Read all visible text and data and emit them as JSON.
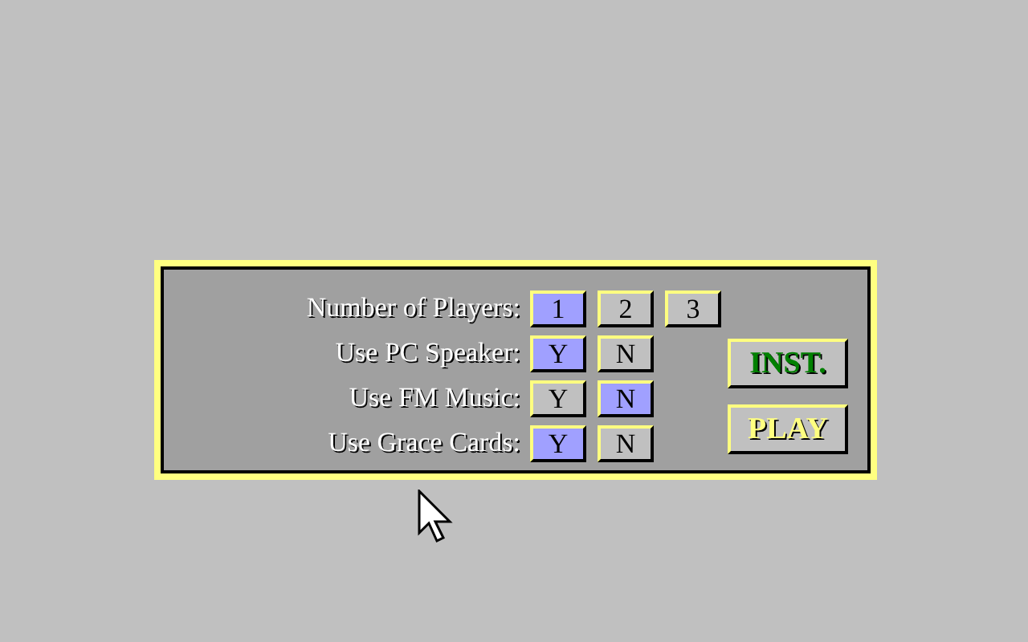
{
  "settings": [
    {
      "label": "Number of Players:",
      "options": [
        {
          "label": "1",
          "selected": true
        },
        {
          "label": "2",
          "selected": false
        },
        {
          "label": "3",
          "selected": false
        }
      ]
    },
    {
      "label": "Use PC Speaker:",
      "options": [
        {
          "label": "Y",
          "selected": true
        },
        {
          "label": "N",
          "selected": false
        }
      ]
    },
    {
      "label": "Use FM Music:",
      "options": [
        {
          "label": "Y",
          "selected": false
        },
        {
          "label": "N",
          "selected": true
        }
      ]
    },
    {
      "label": "Use Grace Cards:",
      "options": [
        {
          "label": "Y",
          "selected": true
        },
        {
          "label": "N",
          "selected": false
        }
      ]
    }
  ],
  "actions": [
    {
      "label": "INST.",
      "color": "#008000"
    },
    {
      "label": "PLAY",
      "color": "#ffff80"
    }
  ]
}
